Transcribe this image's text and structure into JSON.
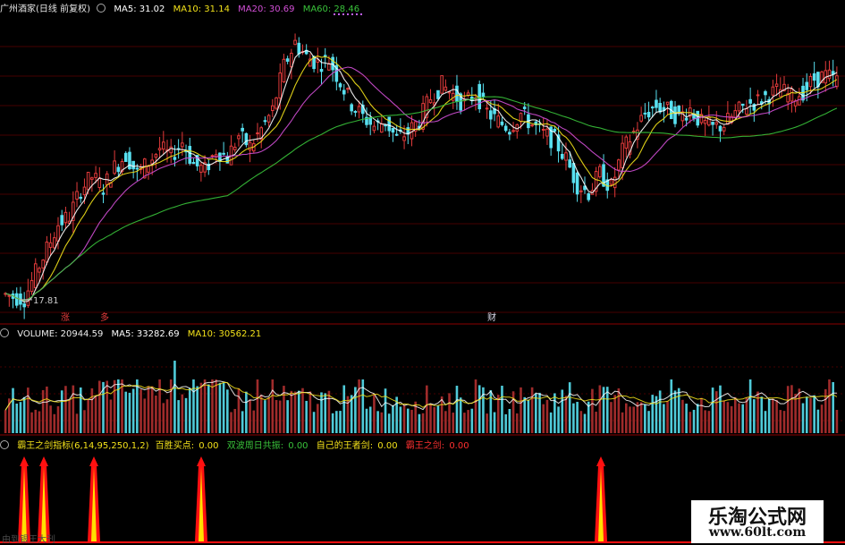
{
  "main_panel": {
    "stock": "广州酒家(日线 前复权)",
    "ma5": "MA5: 31.02",
    "ma10": "MA10: 31.14",
    "ma20": "MA20: 30.69",
    "ma60": "MA60: 28.46",
    "low_label": "17.81",
    "markers": [
      "涨",
      "多",
      "财"
    ]
  },
  "volume_panel": {
    "volume": "VOLUME: 20944.59",
    "ma5": "MA5: 33282.69",
    "ma10": "MA10: 30562.21"
  },
  "indicator_panel": {
    "name": "霸王之剑指标(6,14,95,250,1,2)",
    "label1": "百胜买点:",
    "value1": "0.00",
    "label2": "双波周日共振:",
    "value2": "0.00",
    "label3": "自己的王者剑:",
    "value3": "0.00",
    "label4": "霸王之剑:",
    "value4": "0.00",
    "bottom_text": "由到银王大刊"
  },
  "watermark": {
    "title": "乐淘公式网",
    "url": "www.60lt.com"
  },
  "colors": {
    "up": "#e23b3b",
    "down": "#58e0f0",
    "ma5": "#ffffff",
    "ma10": "#f3e21a",
    "ma20": "#d24fd6",
    "ma60": "#39c23a",
    "grid": "#8b0000",
    "signal": "#ff1010",
    "signal_tip": "#ffe000"
  },
  "chart_data": [
    {
      "type": "candlestick",
      "title": "广州酒家(日线 前复权)",
      "series": [
        {
          "name": "MA5",
          "value": 31.02
        },
        {
          "name": "MA10",
          "value": 31.14
        },
        {
          "name": "MA20",
          "value": 30.69
        },
        {
          "name": "MA60",
          "value": 28.46
        }
      ],
      "low_marker": 17.81,
      "close": [
        18.2,
        18.0,
        17.9,
        19.5,
        21.0,
        22.6,
        23.1,
        24.8,
        25.6,
        24.9,
        26.2,
        27.0,
        25.8,
        26.5,
        27.4,
        26.9,
        27.8,
        26.4,
        26.0,
        27.3,
        26.8,
        28.2,
        27.5,
        28.6,
        29.8,
        32.6,
        34.1,
        33.2,
        32.8,
        33.0,
        31.6,
        30.2,
        29.4,
        28.8,
        29.1,
        28.0,
        28.4,
        29.2,
        30.6,
        31.4,
        30.8,
        30.2,
        30.9,
        29.7,
        29.1,
        28.7,
        29.6,
        28.9,
        28.3,
        27.9,
        26.7,
        25.1,
        24.6,
        25.8,
        24.9,
        27.2,
        28.4,
        29.6,
        30.1,
        29.8,
        29.4,
        29.9,
        29.0,
        28.7,
        28.9,
        29.6,
        30.2,
        30.4,
        30.8,
        31.1,
        30.6,
        31.0,
        31.8,
        32.0,
        31.7
      ]
    },
    {
      "type": "bar",
      "title": "VOLUME",
      "series": [
        {
          "name": "VOLUME",
          "value": 20944.59
        },
        {
          "name": "MA5",
          "value": 33282.69
        },
        {
          "name": "MA10",
          "value": 30562.21
        }
      ]
    },
    {
      "type": "bar",
      "title": "霸王之剑指标(6,14,95,250,1,2)",
      "signals": [
        {
          "name": "百胜买点",
          "value": 0.0
        },
        {
          "name": "双波周日共振",
          "value": 0.0
        },
        {
          "name": "自己的王者剑",
          "value": 0.0
        },
        {
          "name": "霸王之剑",
          "value": 0.0
        }
      ],
      "spike_bar_index": [
        2,
        4,
        9,
        20,
        60
      ]
    }
  ]
}
